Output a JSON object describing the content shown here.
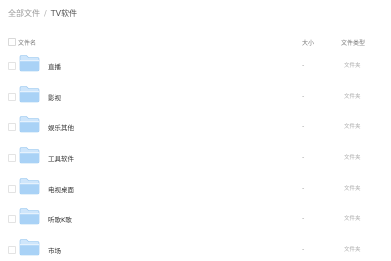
{
  "breadcrumb": {
    "root": "全部文件",
    "separator": "/",
    "current": "TV软件"
  },
  "table": {
    "headers": {
      "name": "文件名",
      "size": "大小",
      "type": "文件类型"
    },
    "rows": [
      {
        "name": "直播",
        "size": "-",
        "type": "文件夹"
      },
      {
        "name": "影视",
        "size": "-",
        "type": "文件夹"
      },
      {
        "name": "娱乐其他",
        "size": "-",
        "type": "文件夹"
      },
      {
        "name": "工具软件",
        "size": "-",
        "type": "文件夹"
      },
      {
        "name": "电视桌面",
        "size": "-",
        "type": "文件夹"
      },
      {
        "name": "听歌K歌",
        "size": "-",
        "type": "文件夹"
      },
      {
        "name": "市场",
        "size": "-",
        "type": "文件夹"
      }
    ]
  },
  "icons": {
    "row_icon": "folder-icon"
  },
  "colors": {
    "folder_light": "#cfe6fb",
    "folder_dark": "#7fb8ec",
    "text_primary": "#333333",
    "text_muted": "#999999"
  }
}
